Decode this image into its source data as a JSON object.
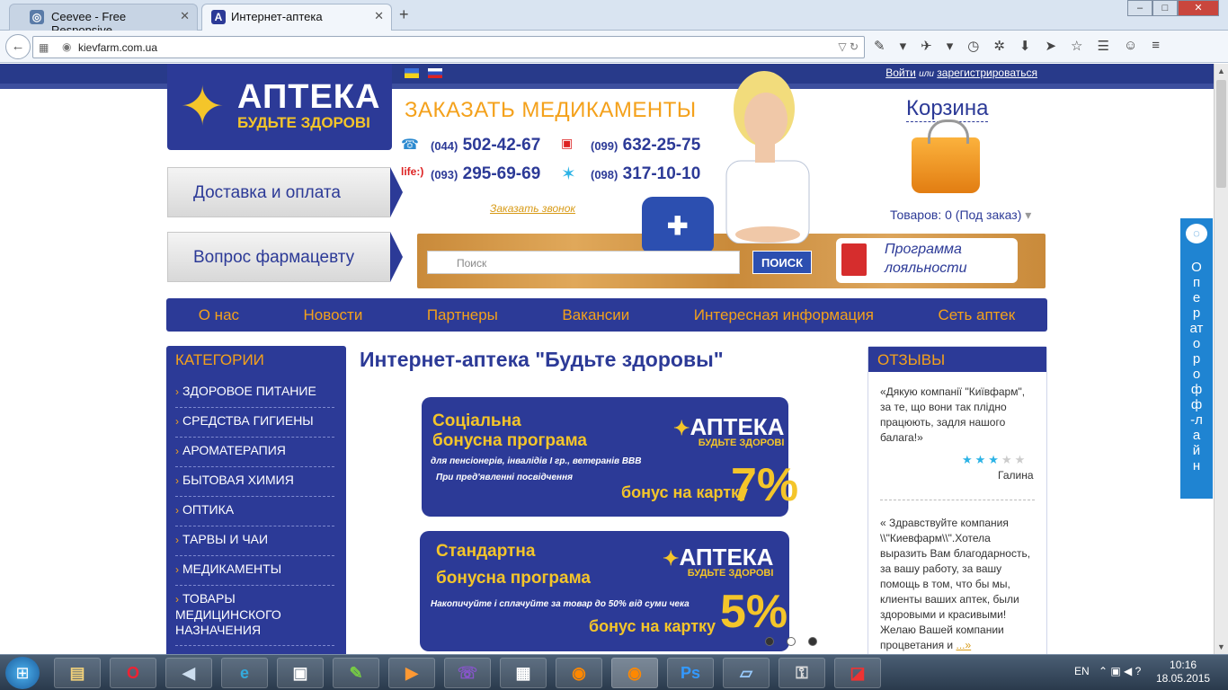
{
  "browser": {
    "tabs": [
      {
        "label": "Ceevee - Free Responsive ...",
        "icon": "ceevee-favicon"
      },
      {
        "label": "Интернет-аптека",
        "icon": "apteka-favicon"
      }
    ],
    "url": "kievfarm.com.ua",
    "window_buttons": [
      "–",
      "□",
      "✕"
    ]
  },
  "site": {
    "login": {
      "login": "Войти",
      "or": "или",
      "register": "зарегистрироваться"
    },
    "logo": {
      "line1": "АПТЕКА",
      "line2": "БУДЬТЕ ЗДОРОВІ"
    },
    "side_buttons": [
      "Доставка и оплата",
      "Вопрос фармацевту"
    ],
    "order_title": "ЗАКАЗАТЬ МЕДИКАМЕНТЫ",
    "phones": [
      {
        "code": "(044)",
        "number": "502-42-67",
        "operator": "phone"
      },
      {
        "code": "(099)",
        "number": "632-25-75",
        "operator": "mts"
      },
      {
        "code": "(093)",
        "number": "295-69-69",
        "operator": "life"
      },
      {
        "code": "(098)",
        "number": "317-10-10",
        "operator": "kyivstar"
      }
    ],
    "callback": "Заказать звонок",
    "search": {
      "placeholder": "Поиск",
      "button": "ПОИСК"
    },
    "loyalty": "Программа лояльности",
    "cart": {
      "title": "Корзина",
      "info": "Товаров: 0 (Под заказ)"
    },
    "nav": [
      "О нас",
      "Новости",
      "Партнеры",
      "Вакансии",
      "Интересная информация",
      "Сеть аптек"
    ],
    "categories": {
      "title": "КАТЕГОРИИ",
      "items": [
        "ЗДОРОВОЕ ПИТАНИЕ",
        "СРЕДСТВА ГИГИЕНЫ",
        "АРОМАТЕРАПИЯ",
        "БЫТОВАЯ ХИМИЯ",
        "ОПТИКА",
        "ТАРВЫ И ЧАИ",
        "МЕДИКАМЕНТЫ",
        "ТОВАРЫ МЕДИЦИНСКОГО НАЗНАЧЕНИЯ"
      ]
    },
    "headline": "Интернет-аптека \"Будьте здоровы\"",
    "banners": [
      {
        "title1": "Соціальна",
        "title2": "бонусна програма",
        "sub1": "для пенсіонерів, інвалідів I гр., ветеранів ВВВ",
        "sub2": "При пред'явленні посвідчення",
        "bonus": "бонус на картку",
        "percent": "7%",
        "logo1": "АПТЕКА",
        "logo2": "БУДЬТЕ ЗДОРОВІ"
      },
      {
        "title1": "Стандартна",
        "title2": "бонусна програма",
        "sub1": "Накопичуйте і сплачуйте за товар до 50% від суми чека",
        "sub2": "",
        "bonus": "бонус на картку",
        "percent": "5%",
        "logo1": "АПТЕКА",
        "logo2": "БУДЬТЕ ЗДОРОВІ"
      }
    ],
    "reviews": {
      "title": "ОТЗЫВЫ",
      "items": [
        {
          "text": "«Дякую компанії \"Київфарм\", за те, що вони так плідно працюють, задля нашого балага!»",
          "name": "Галина",
          "rating": 3,
          "max": 5
        },
        {
          "text": "« Здравствуйте компания \\\\\"Киевфарм\\\\\".Хотела выразить Вам благодарность, за вашу работу, за вашу помощь в том, что бы мы, клиенты ваших аптек, были здоровыми и красивыми! Желаю Вашей компании процветания и",
          "more": "...»"
        }
      ]
    },
    "operator_tab": "Оператор офф-лайн"
  },
  "taskbar": {
    "lang": "EN",
    "time": "10:16",
    "date": "18.05.2015"
  },
  "colors": {
    "brand_blue": "#2c3a97",
    "brand_orange": "#f4a11b",
    "accent_yellow": "#f4c52a"
  }
}
